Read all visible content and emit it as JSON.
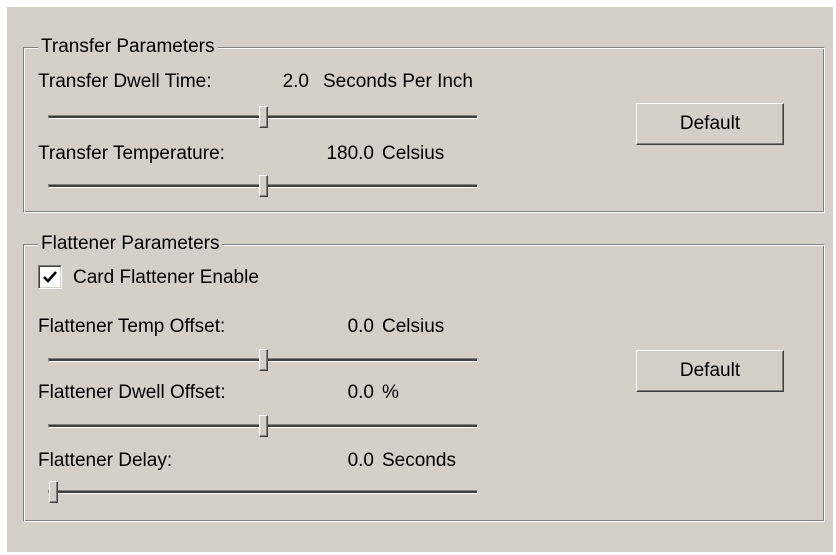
{
  "transfer": {
    "title": "Transfer Parameters",
    "dwell": {
      "label": "Transfer Dwell Time:",
      "value": "2.0",
      "unit": "Seconds Per Inch",
      "slider_fraction": 0.5
    },
    "temperature": {
      "label": "Transfer Temperature:",
      "value": "180.0",
      "unit": "Celsius",
      "slider_fraction": 0.5
    },
    "default_label": "Default"
  },
  "flattener": {
    "title": "Flattener Parameters",
    "enable": {
      "label": "Card Flattener Enable",
      "checked": true
    },
    "temp_offset": {
      "label": "Flattener Temp Offset:",
      "value": "0.0",
      "unit": "Celsius",
      "slider_fraction": 0.5
    },
    "dwell_offset": {
      "label": "Flattener Dwell Offset:",
      "value": "0.0",
      "unit": "%",
      "slider_fraction": 0.5
    },
    "delay": {
      "label": "Flattener Delay:",
      "value": "0.0",
      "unit": "Seconds",
      "slider_fraction": 0.0
    },
    "default_label": "Default"
  },
  "icons": {
    "checkmark": "checkmark-icon"
  }
}
